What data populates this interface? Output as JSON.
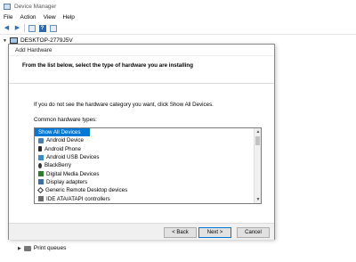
{
  "window": {
    "title": "Device Manager",
    "menu": [
      "File",
      "Action",
      "View",
      "Help"
    ],
    "computer_name": "DESKTOP-2779J5V",
    "bottom_item": "Print queues"
  },
  "dialog": {
    "title": "Add Hardware",
    "heading": "From the list below, select the type of hardware you are installing",
    "info": "If you do not see the hardware category you want, click Show All Devices.",
    "common_label": "Common hardware types:",
    "items": [
      {
        "label": "Show All Devices",
        "icon": "none",
        "selected": true
      },
      {
        "label": "Android Device",
        "icon": "android-device-icon"
      },
      {
        "label": "Android Phone",
        "icon": "phone-icon"
      },
      {
        "label": "Android USB Devices",
        "icon": "usb-icon"
      },
      {
        "label": "BlackBerry",
        "icon": "blackberry-icon"
      },
      {
        "label": "Digital Media Devices",
        "icon": "media-device-icon"
      },
      {
        "label": "Display adapters",
        "icon": "display-adapter-icon"
      },
      {
        "label": "Generic Remote Desktop devices",
        "icon": "remote-desktop-icon"
      },
      {
        "label": "IDE ATA/ATAPI controllers",
        "icon": "ide-controller-icon"
      }
    ],
    "buttons": {
      "back": "< Back",
      "next": "Next >",
      "cancel": "Cancel"
    }
  }
}
